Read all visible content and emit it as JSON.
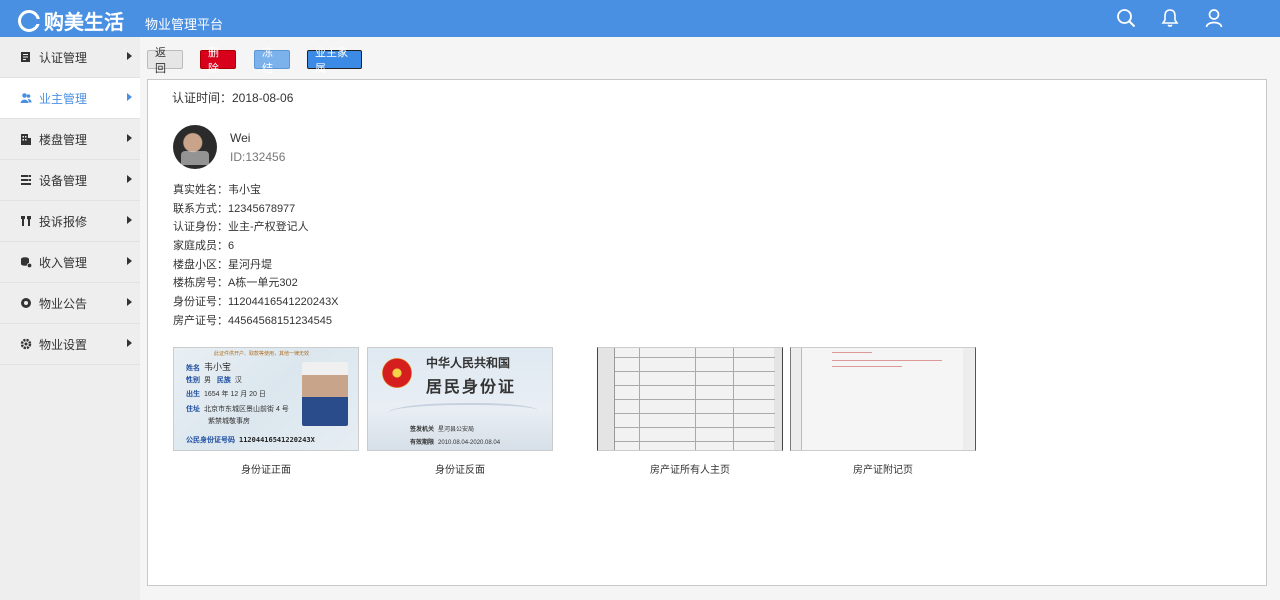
{
  "header": {
    "brand": "购美生活",
    "platform": "物业管理平台",
    "icons": [
      "search-icon",
      "bell-icon",
      "user-icon"
    ]
  },
  "sidebar": {
    "items": [
      {
        "label": "认证管理",
        "icon": "id-card-icon",
        "active": false
      },
      {
        "label": "业主管理",
        "icon": "users-icon",
        "active": true
      },
      {
        "label": "楼盘管理",
        "icon": "building-icon",
        "active": false
      },
      {
        "label": "设备管理",
        "icon": "device-icon",
        "active": false
      },
      {
        "label": "投诉报修",
        "icon": "tools-icon",
        "active": false
      },
      {
        "label": "收入管理",
        "icon": "income-icon",
        "active": false
      },
      {
        "label": "物业公告",
        "icon": "announce-icon",
        "active": false
      },
      {
        "label": "物业设置",
        "icon": "gear-icon",
        "active": false
      }
    ]
  },
  "toolbar": {
    "back": "返回",
    "delete": "删除",
    "freeze": "冻结",
    "family": "业主家属"
  },
  "profile": {
    "auth_time": "认证时间：2018-08-06",
    "name": "Wei",
    "id": "ID:132456",
    "fields": [
      "真实姓名：韦小宝",
      "联系方式：12345678977",
      "认证身份：业主-产权登记人",
      "家庭成员：6",
      "楼盘小区：星河丹堤",
      "楼栋房号：A栋一单元302",
      "身份证号：11204416541220243X",
      "房产证号：44564568151234545"
    ]
  },
  "documents": {
    "captions": [
      "身份证正面",
      "身份证反面",
      "房产证所有人主页",
      "房产证附记页"
    ],
    "id_front": {
      "notice": "此证件供开户、取款等使用，其他一律无效",
      "name_label": "姓名",
      "name": "韦小宝",
      "sex_label": "性别",
      "sex": "男",
      "nation_label": "民族",
      "nation": "汉",
      "birth_label": "出生",
      "birth": "1654 年 12 月 20 日",
      "addr_label": "住址",
      "addr1": "北京市东城区景山前街 4 号",
      "addr2": "紫禁城敬事房",
      "num_label": "公民身份证号码",
      "num": "11204416541220243X"
    },
    "id_back": {
      "title1": "中华人民共和国",
      "title2": "居民身份证",
      "authority_label": "签发机关",
      "authority": "星河县公安局",
      "valid_label": "有效期限",
      "valid": "2010.08.04-2020.08.04"
    }
  }
}
